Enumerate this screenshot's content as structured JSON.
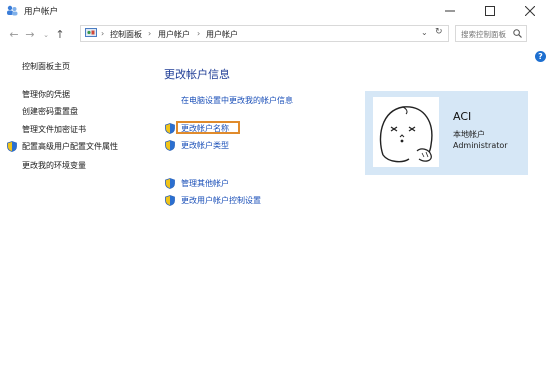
{
  "window": {
    "title": "用户帐户"
  },
  "address": {
    "crumbs": [
      "控制面板",
      "用户帐户",
      "用户帐户"
    ]
  },
  "search": {
    "placeholder": "搜索控制面板"
  },
  "sidebar": {
    "items": [
      {
        "label": "控制面板主页"
      },
      {
        "label": "管理你的凭据"
      },
      {
        "label": "创建密码重置盘"
      },
      {
        "label": "管理文件加密证书"
      },
      {
        "label": "配置高级用户配置文件属性"
      },
      {
        "label": "更改我的环境变量"
      }
    ]
  },
  "main": {
    "title": "更改帐户信息",
    "links": [
      {
        "label": "在电脑设置中更改我的帐户信息"
      },
      {
        "label": "更改帐户名称"
      },
      {
        "label": "更改帐户类型"
      },
      {
        "label": "管理其他帐户"
      },
      {
        "label": "更改用户帐户控制设置"
      }
    ]
  },
  "account": {
    "name": "ACI",
    "type": "本地帐户",
    "role": "Administrator"
  },
  "colors": {
    "highlight": "#e08b2c",
    "link": "#1a4fb8",
    "panel": "#d6e7f6"
  },
  "icons": [
    "users-icon",
    "back-icon",
    "forward-icon",
    "recent-icon",
    "up-icon",
    "control-panel-icon",
    "refresh-icon",
    "search-icon",
    "help-icon",
    "shield-icon"
  ]
}
